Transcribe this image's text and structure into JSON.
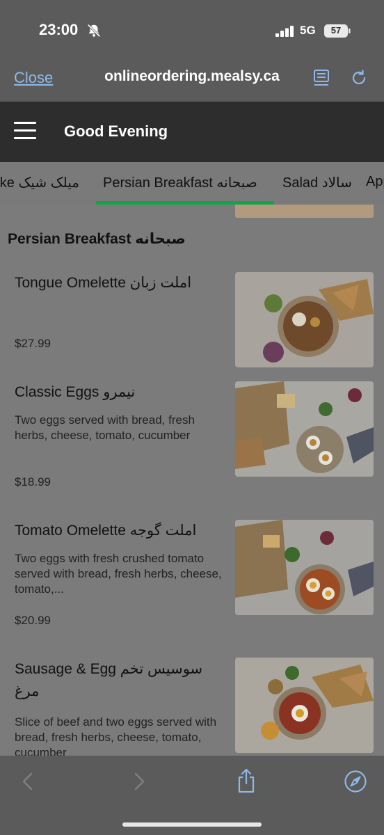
{
  "status_bar": {
    "time": "23:00",
    "network": "5G",
    "battery": "57"
  },
  "browser": {
    "close_label": "Close",
    "url": "onlineordering.mealsy.ca"
  },
  "header": {
    "greeting": "Good Evening"
  },
  "tabs": [
    {
      "label": "Milkshake میلک شیک"
    },
    {
      "label": "Persian Breakfast صبحانه"
    },
    {
      "label": "Salad سالاد"
    },
    {
      "label": "Appetizers"
    }
  ],
  "active_tab": "Persian Breakfast صبحانه",
  "section": {
    "title": "Persian Breakfast صبحانه"
  },
  "items": [
    {
      "name": "Tongue Omelette املت زبان",
      "description": "",
      "price": "$27.99"
    },
    {
      "name": "Classic Eggs نیمرو",
      "description": "Two eggs served with bread, fresh herbs, cheese, tomato, cucumber",
      "price": "$18.99"
    },
    {
      "name": "Tomato Omelette املت گوجه",
      "description": "Two eggs with fresh crushed tomato served with bread, fresh herbs, cheese, tomato,...",
      "price": "$20.99"
    },
    {
      "name": "Sausage & Egg سوسیس تخم مرغ",
      "description": "Slice of beef and two eggs served with bread, fresh herbs, cheese, tomato, cucumber",
      "price": ""
    }
  ],
  "colors": {
    "active_tab_underline": "#15a34a",
    "header_bg": "#2d2d2d",
    "link": "#8fb8e8"
  },
  "icons": {
    "bell": "bell-slash-icon",
    "signal": "cellular-signal-icon",
    "battery": "battery-icon",
    "reader": "reader-view-icon",
    "reload": "reload-icon",
    "menu": "hamburger-menu-icon",
    "back": "chevron-left-icon",
    "forward": "chevron-right-icon",
    "share": "share-icon",
    "compass": "compass-icon"
  }
}
